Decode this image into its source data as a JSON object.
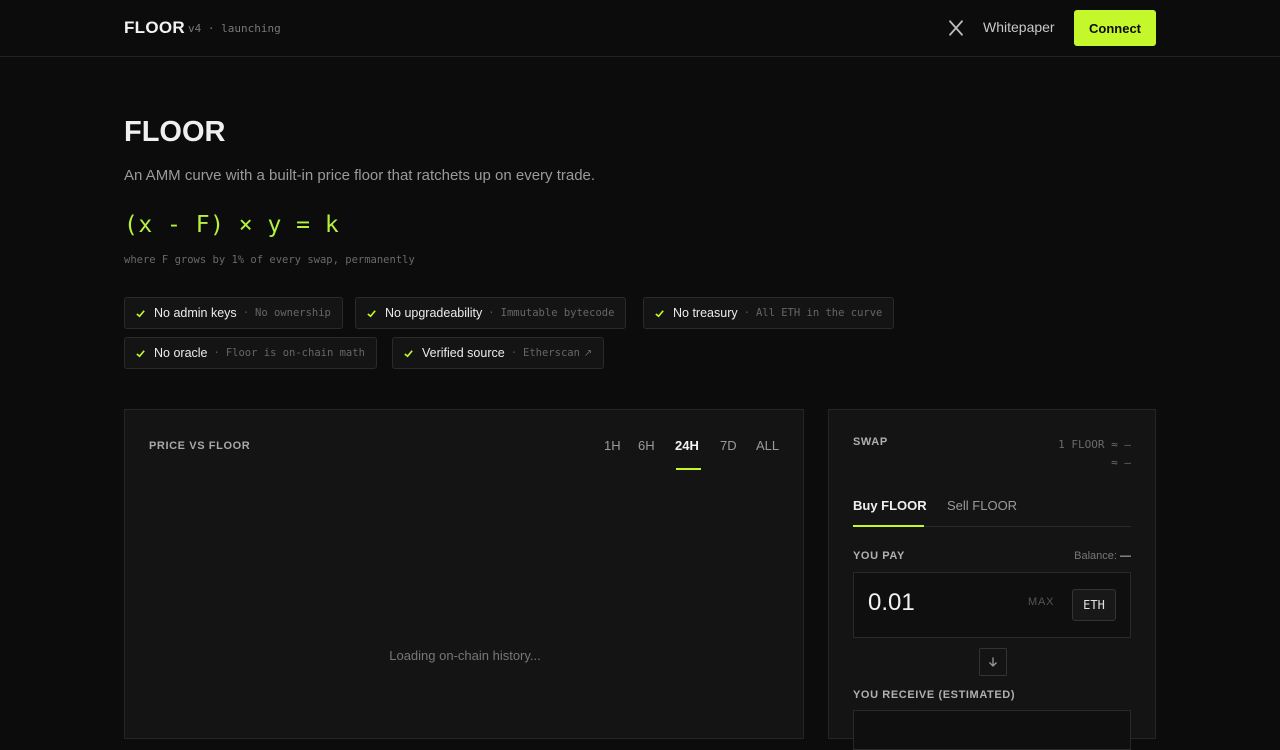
{
  "header": {
    "brand": "FLOOR",
    "version_status": "v4 · launching",
    "x_link_icon": "x-logo-icon",
    "whitepaper_label": "Whitepaper",
    "connect_label": "Connect"
  },
  "hero": {
    "title": "FLOOR",
    "subtitle": "An AMM curve with a built-in price floor that ratchets up on every trade.",
    "formula": "(x - F) × y = k",
    "formula_note": "where F grows by 1% of every swap, permanently"
  },
  "badges": [
    {
      "label": "No admin keys",
      "sub": "No ownership"
    },
    {
      "label": "No upgradeability",
      "sub": "Immutable bytecode"
    },
    {
      "label": "No treasury",
      "sub": "All ETH in the curve"
    },
    {
      "label": "No oracle",
      "sub": "Floor is on-chain math"
    },
    {
      "label": "Verified source",
      "sub": "Etherscan",
      "link_arrow": "↗"
    }
  ],
  "badge_separator": "·",
  "chart": {
    "title": "PRICE VS FLOOR",
    "ranges": [
      "1H",
      "6H",
      "24H",
      "7D",
      "ALL"
    ],
    "active_range": "24H",
    "loading_text": "Loading on-chain history..."
  },
  "swap": {
    "title": "SWAP",
    "rate_line1": "1 FLOOR ≈ —",
    "rate_line2": "≈ —",
    "tabs": [
      "Buy FLOOR",
      "Sell FLOOR"
    ],
    "active_tab": "Buy FLOOR",
    "pay_label": "YOU PAY",
    "balance_label": "Balance:",
    "balance_value": "—",
    "pay_amount": "0.01",
    "max_label": "MAX",
    "pay_token": "ETH",
    "flip_icon": "arrow-down-icon",
    "receive_label": "YOU RECEIVE (ESTIMATED)"
  },
  "colors": {
    "accent": "#c5f82a",
    "formula": "#b6f040",
    "background": "#0c0c0c",
    "panel": "#141414"
  }
}
